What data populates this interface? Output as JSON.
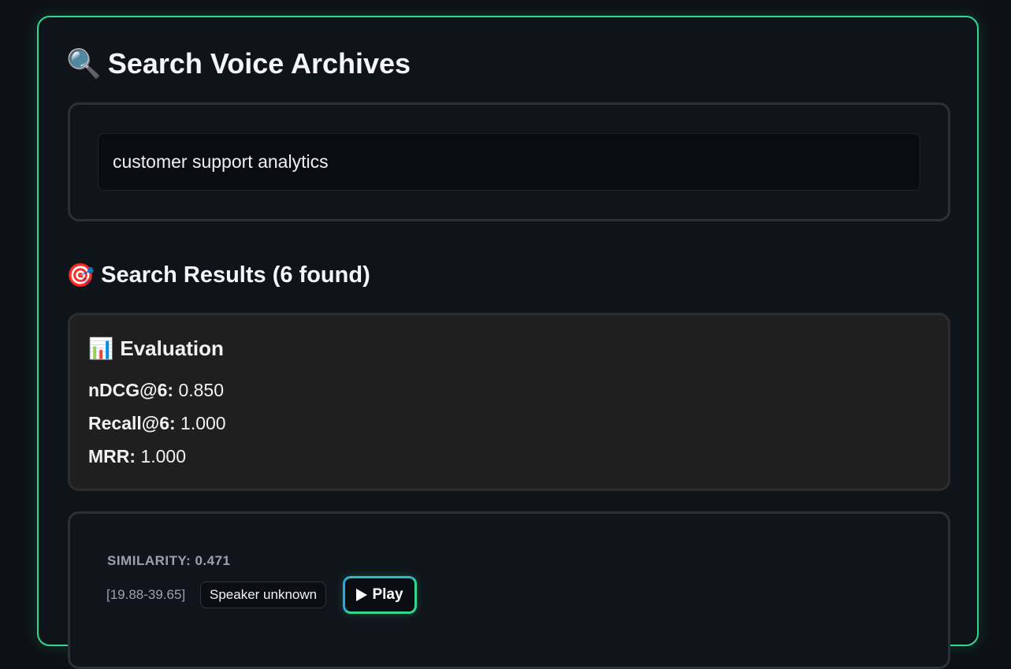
{
  "header": {
    "title_icon": "🔍",
    "title_icon_name": "magnifier-icon",
    "title": "Search Voice Archives"
  },
  "search": {
    "value": "customer support analytics"
  },
  "results": {
    "heading_icon": "🎯",
    "heading_icon_name": "target-icon",
    "heading": "Search Results (6 found)"
  },
  "evaluation": {
    "icon": "📊",
    "icon_name": "bar-chart-icon",
    "title": "Evaluation",
    "metrics": [
      {
        "label": "nDCG@6:",
        "value": "0.850"
      },
      {
        "label": "Recall@6:",
        "value": "1.000"
      },
      {
        "label": "MRR:",
        "value": "1.000"
      }
    ]
  },
  "result_items": [
    {
      "similarity": "SIMILARITY: 0.471",
      "timestamp": "[19.88-39.65]",
      "speaker": "Speaker unknown",
      "play_icon": "play-icon",
      "play_label": "Play"
    }
  ],
  "colors": {
    "accent": "#2fd88f",
    "accent_secondary": "#2aa8e0",
    "background": "#0d1117"
  }
}
